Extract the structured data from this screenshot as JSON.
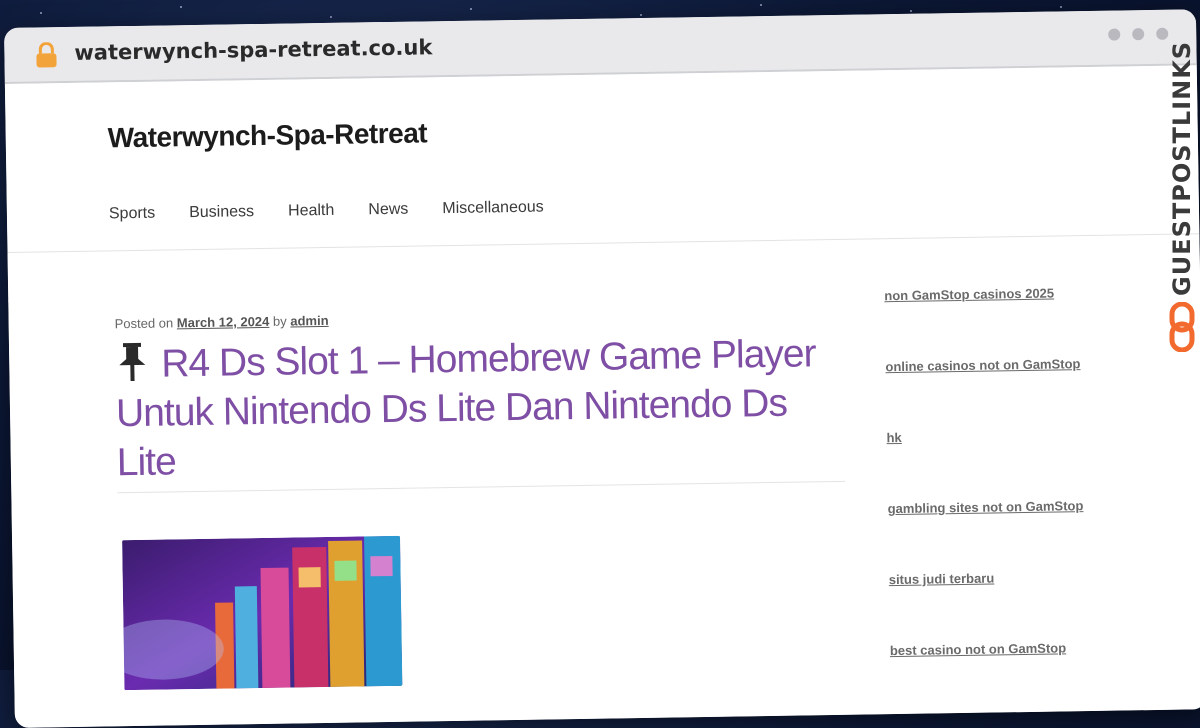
{
  "browser": {
    "url": "waterwynch-spa-retreat.co.uk"
  },
  "site": {
    "title": "Waterwynch-Spa-Retreat",
    "nav": [
      "Sports",
      "Business",
      "Health",
      "News",
      "Miscellaneous"
    ]
  },
  "post": {
    "posted_on_label": "Posted on",
    "date": "March 12, 2024",
    "by_label": "by",
    "author": "admin",
    "title": "R4 Ds Slot 1 – Homebrew Game Player Untuk Nintendo Ds Lite Dan Nintendo Ds Lite",
    "icon": "pushpin-icon"
  },
  "sidebar": {
    "links": [
      "non GamStop casinos 2025",
      "online casinos not on GamStop",
      "hk",
      "gambling sites not on GamStop",
      "situs judi terbaru",
      "best casino not on GamStop"
    ]
  },
  "badge": {
    "text": "GUESTPOSTLINKS",
    "accent": "#f26a2e"
  },
  "colors": {
    "title": "#7e4fa4",
    "lock": "#f2a33a",
    "background": "#0c1836"
  }
}
